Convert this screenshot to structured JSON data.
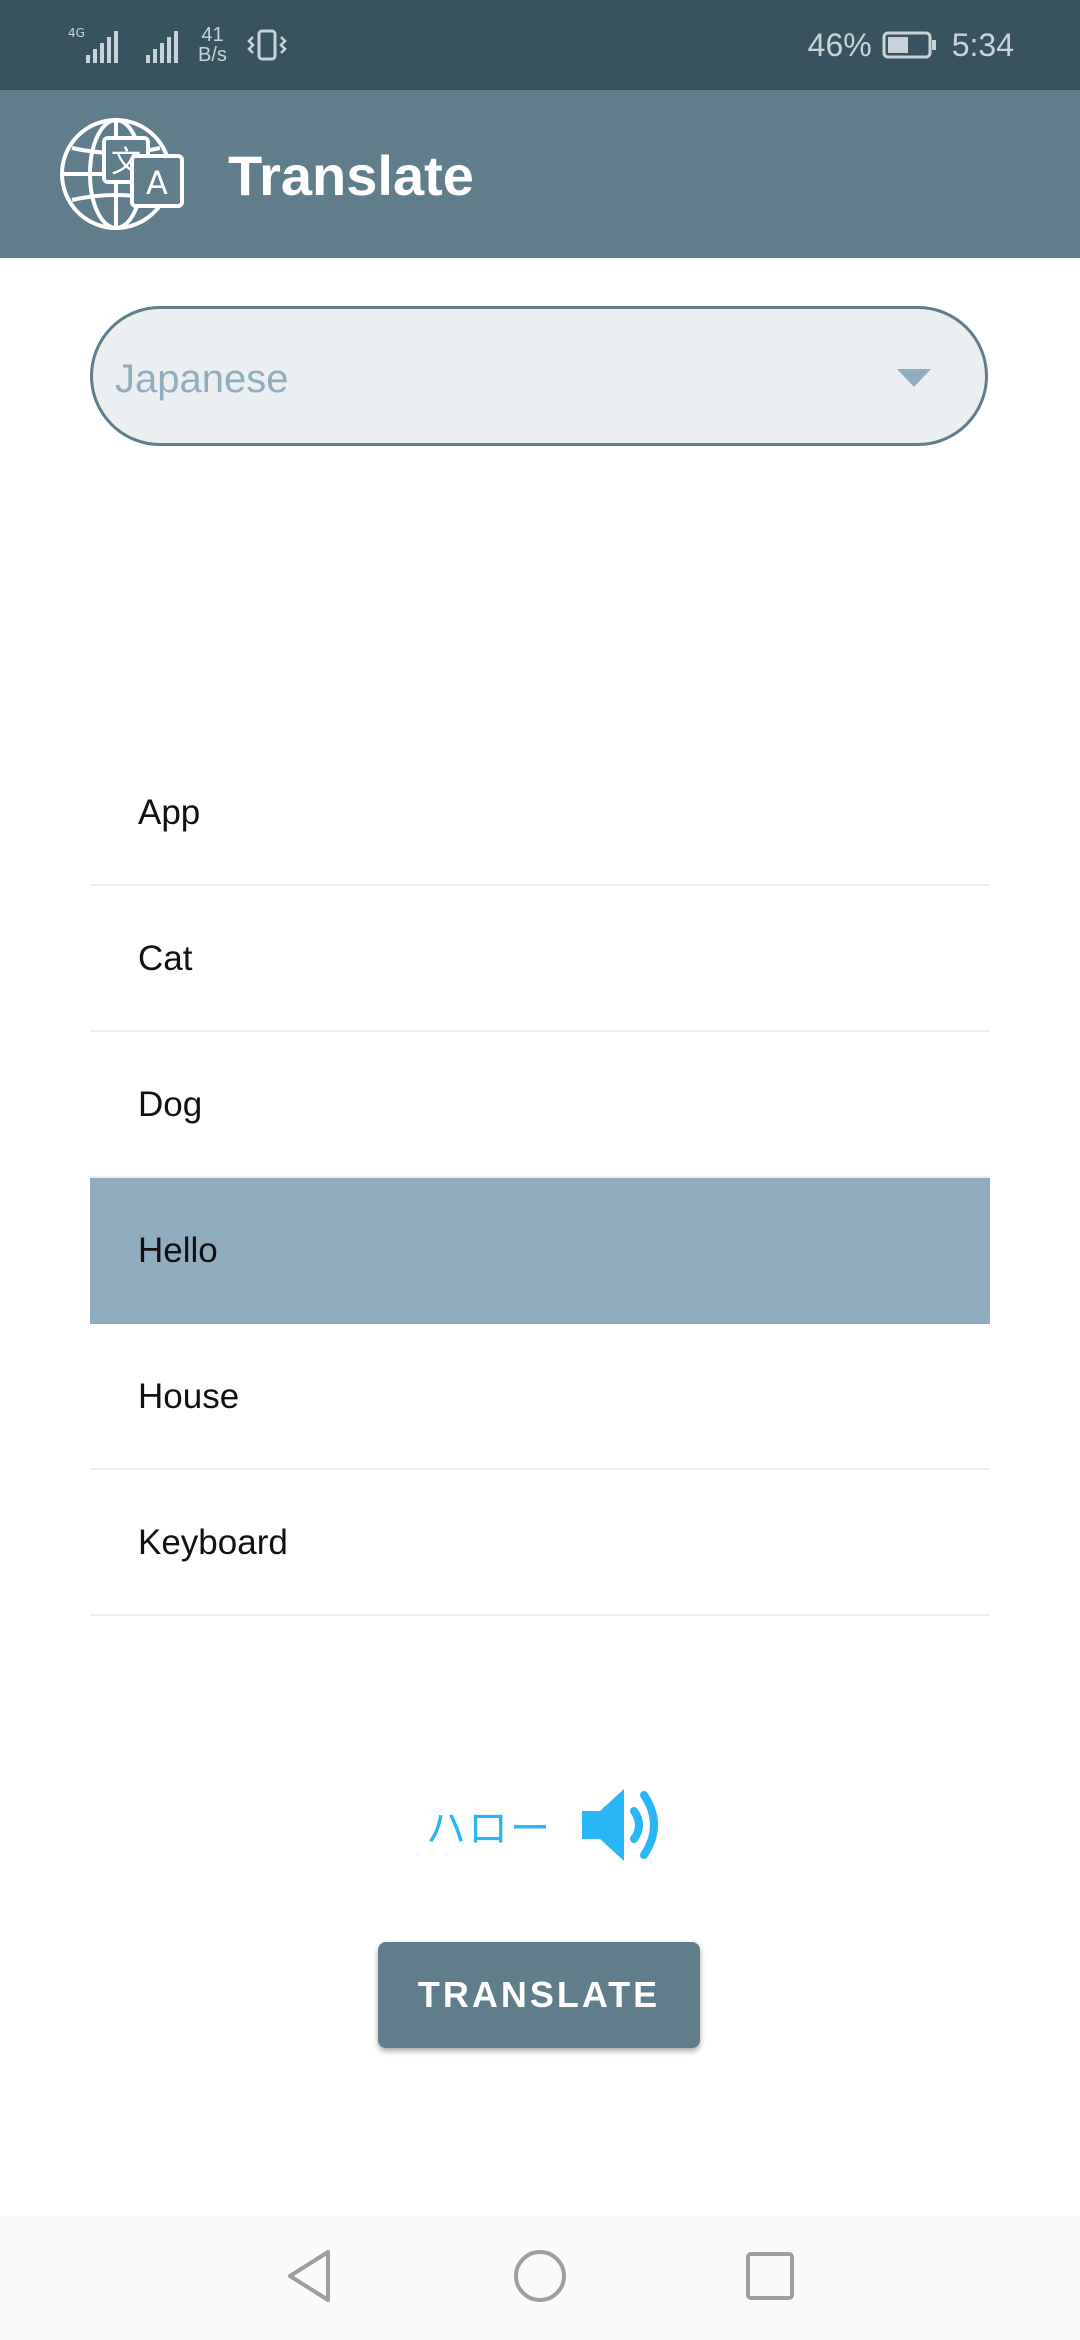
{
  "status_bar": {
    "network_type": "4G",
    "net_speed_value": "41",
    "net_speed_unit": "B/s",
    "battery_percent": "46%",
    "time": "5:34"
  },
  "app_bar": {
    "title": "Translate",
    "logo_icon": "globe-translate-icon"
  },
  "language_select": {
    "selected": "Japanese"
  },
  "words": [
    {
      "label": "App"
    },
    {
      "label": "Cat"
    },
    {
      "label": "Dog"
    },
    {
      "label": "Hello"
    },
    {
      "label": "House"
    },
    {
      "label": "Keyboard"
    }
  ],
  "selected_word_index": 3,
  "result": {
    "translation": "ハロー",
    "speaker_icon": "volume-up-icon"
  },
  "translate_button": {
    "label": "TRANSLATE"
  },
  "nav_bar": {
    "icons": [
      "back-icon",
      "home-icon",
      "recents-icon"
    ]
  },
  "colors": {
    "status_bar": "#37535f",
    "app_bar": "#607d8b",
    "accent": "#29b6f6",
    "selected_row": "#8fadbe"
  }
}
